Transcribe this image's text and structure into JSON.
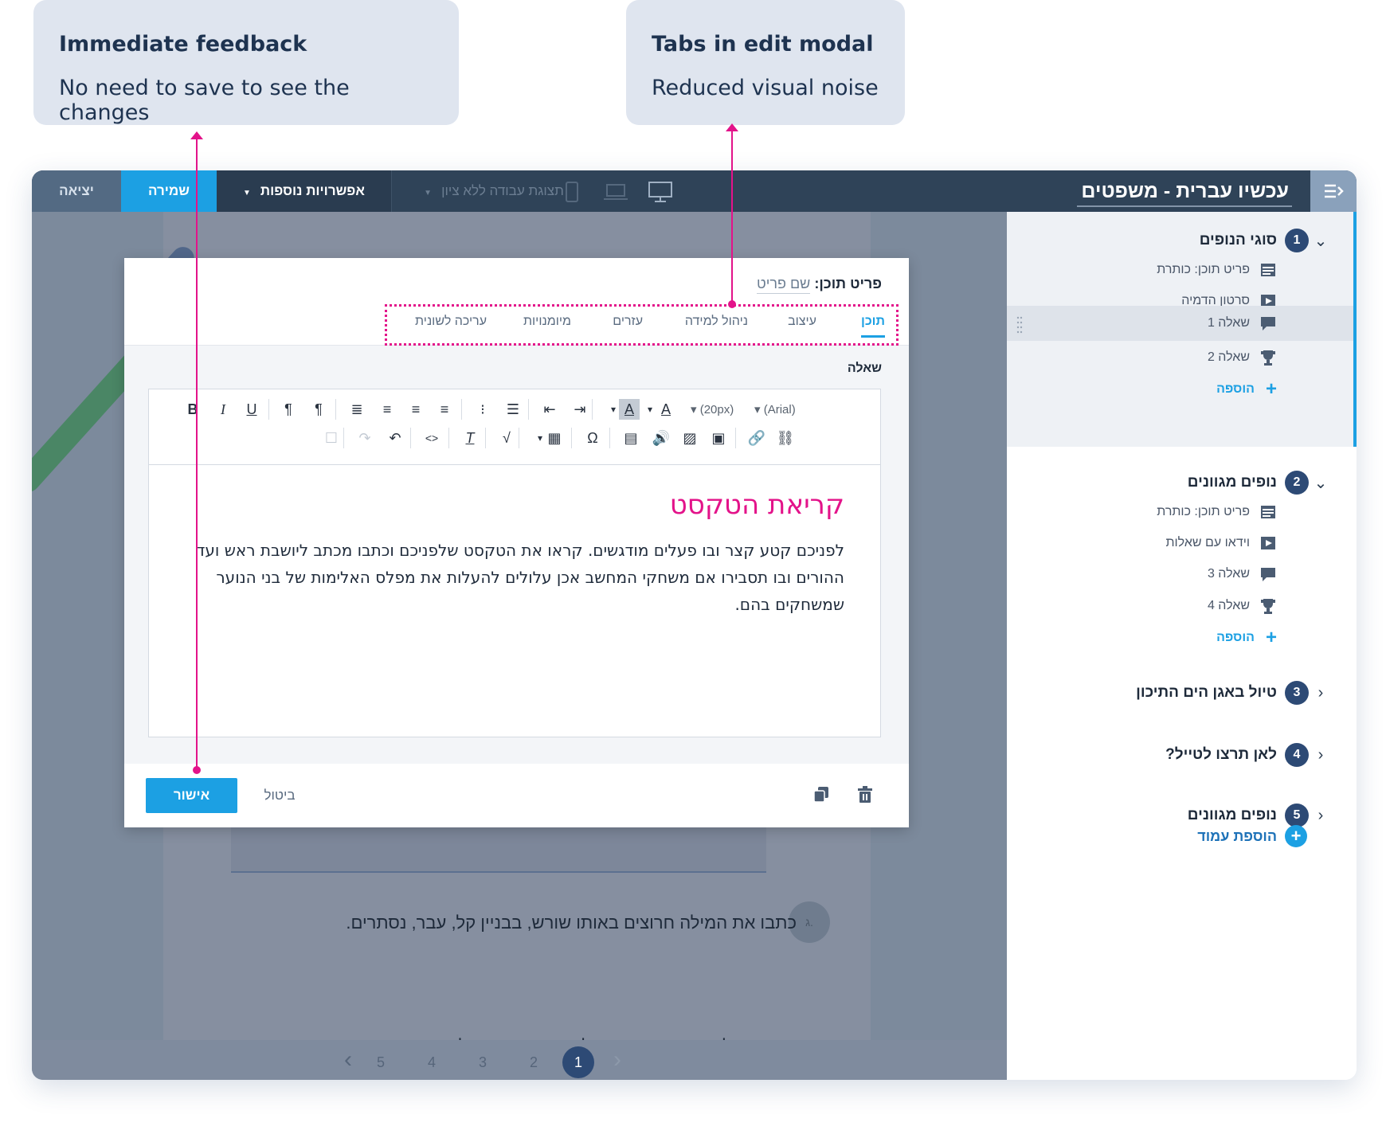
{
  "callouts": [
    {
      "title": "Immediate feedback",
      "body": "No need to save to see the changes"
    },
    {
      "title": "Tabs in edit modal",
      "body": "Reduced visual noise"
    }
  ],
  "topbar": {
    "exit": "יציאה",
    "save": "שמירה",
    "more_options": "אפשרויות נוספות",
    "view_select": "תצוגת עבודה ללא ציון",
    "course_title": "עכשיו עברית - משפטים"
  },
  "modal": {
    "title_label": "פריט תוכן:",
    "title_name": "שם פריט",
    "tabs": [
      "תוכן",
      "עיצוב",
      "ניהול למידה",
      "עזרים",
      "מיומנויות",
      "עריכה לשונית"
    ],
    "field_label": "שאלה",
    "toolbar": {
      "font_size": "(20px)",
      "font_family": "(Arial)"
    },
    "heading": "קריאת הטקסט",
    "body_text": "לפניכם קטע קצר ובו פעלים מודגשים. קראו את הטקסט שלפניכם וכתבו מכתב ליושבת ראש ועד ההורים ובו תסבירו אם משחקי המחשב אכן עלולים להעלות את מפלס האלימות של בני הנוער שמשחקים בהם.",
    "confirm": "אישור",
    "cancel": "ביטול"
  },
  "canvas": {
    "question_letter": "ג.",
    "question_text": "כתבו את המילה חרוצים באותו שורש, בבניין קל, עבר, נסתרים.",
    "question_line2": "חוצים בלומר ובה מה בחוע לעוסג וב חושווש לדבבה ובם וגובבה",
    "pages": [
      "5",
      "4",
      "3",
      "2",
      "1"
    ],
    "active_page": "1"
  },
  "sidebar": {
    "sections": [
      {
        "num": "1",
        "title": "סוגי הנופים",
        "expanded": true,
        "items": [
          {
            "label": "פריט תוכן: כותרת",
            "icon": "text-block-icon"
          },
          {
            "label": "סרטון הדמיה",
            "icon": "video-icon"
          },
          {
            "label": "שאלה 1",
            "icon": "speech-bubble-icon"
          },
          {
            "label": "שאלה 2",
            "icon": "trophy-icon"
          }
        ],
        "add": "הוספה"
      },
      {
        "num": "2",
        "title": "נופים מגוונים",
        "expanded": true,
        "items": [
          {
            "label": "פריט תוכן: כותרת",
            "icon": "text-block-icon"
          },
          {
            "label": "וידאו עם שאלות",
            "icon": "video-icon"
          },
          {
            "label": "שאלה 3",
            "icon": "speech-bubble-icon"
          },
          {
            "label": "שאלה 4",
            "icon": "trophy-icon"
          }
        ],
        "add": "הוספה"
      },
      {
        "num": "3",
        "title": "טיול באגן הים התיכון",
        "expanded": false
      },
      {
        "num": "4",
        "title": "לאן תרצו לטייל?",
        "expanded": false
      },
      {
        "num": "5",
        "title": "נופים מגוונים",
        "expanded": false
      }
    ],
    "add_page": "הוספת עמוד"
  },
  "colors": {
    "accent": "#1ca0e3",
    "annotation": "#e3138a",
    "topbar": "#2f4358",
    "heading_pink": "#e3138a"
  }
}
